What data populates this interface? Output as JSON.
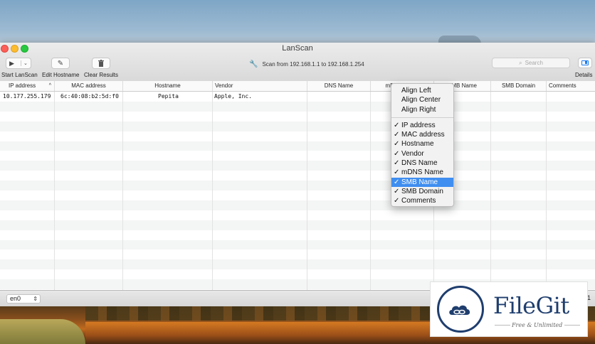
{
  "window": {
    "title": "LanScan"
  },
  "toolbar": {
    "start_label": "Start LanScan",
    "edit_label": "Edit Hostname",
    "clear_label": "Clear Results",
    "details_label": "Details",
    "scan_status": "Scan from 192.168.1.1 to 192.168.1.254",
    "search_placeholder": "Search"
  },
  "table": {
    "columns": [
      "IP address",
      "MAC address",
      "Hostname",
      "Vendor",
      "DNS Name",
      "mDNS Name",
      "SMB Name",
      "SMB Domain",
      "Comments"
    ],
    "sort_indicator": "^",
    "rows": [
      {
        "ip": "10.177.255.179",
        "mac": "6c:40:08:b2:5d:f0",
        "hostname": "Pepita",
        "vendor": "Apple, Inc."
      }
    ]
  },
  "context_menu": {
    "align": [
      "Align Left",
      "Align Center",
      "Align Right"
    ],
    "columns": [
      {
        "label": "IP address",
        "checked": true
      },
      {
        "label": "MAC address",
        "checked": true
      },
      {
        "label": "Hostname",
        "checked": true
      },
      {
        "label": "Vendor",
        "checked": true
      },
      {
        "label": "DNS Name",
        "checked": true
      },
      {
        "label": "mDNS Name",
        "checked": true
      },
      {
        "label": "SMB Name",
        "checked": true,
        "highlighted": true
      },
      {
        "label": "SMB Domain",
        "checked": true
      },
      {
        "label": "Comments",
        "checked": true
      }
    ],
    "check_glyph": "✓"
  },
  "status_bar": {
    "interface": "en0",
    "count": "1"
  },
  "watermark": {
    "brand": "FileGit",
    "tagline": "Free & Unlimited"
  },
  "colors": {
    "accent": "#3f8ef0",
    "brand": "#1f3e6e"
  }
}
